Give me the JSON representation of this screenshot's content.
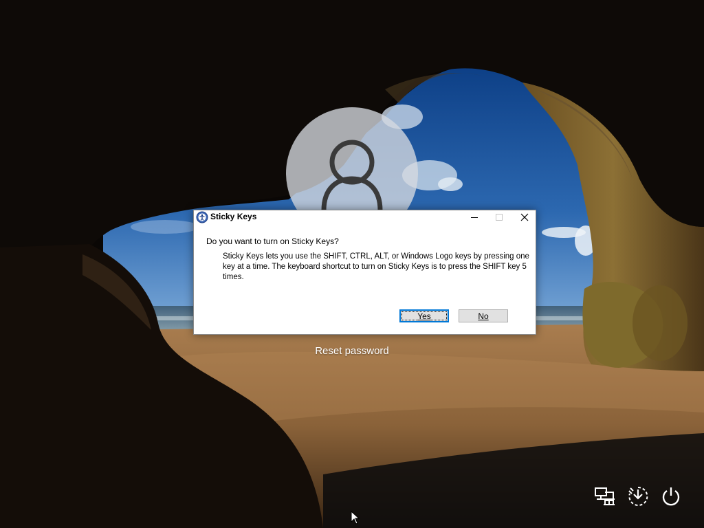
{
  "screen": {
    "type": "Windows lock screen"
  },
  "user": {
    "avatar_icon": "person-icon"
  },
  "reset_password": {
    "label": "Reset password"
  },
  "dialog": {
    "title": "Sticky Keys",
    "title_icon": "ease-of-access-icon",
    "question": "Do you want to turn on Sticky Keys?",
    "body": "Sticky Keys lets you use the SHIFT, CTRL, ALT, or Windows Logo keys by pressing one key at a time. The keyboard shortcut to turn on Sticky Keys is to press the SHIFT key 5 times.",
    "buttons": {
      "yes": "Yes",
      "no": "No"
    },
    "window_controls": [
      "minimize-icon",
      "maximize-icon",
      "close-icon"
    ]
  },
  "tray": {
    "icons": [
      "network-icon",
      "accessibility-icon",
      "power-icon"
    ]
  },
  "colors": {
    "accent": "#0078d7",
    "dialog_bg": "#ffffff",
    "button_bg": "#e1e1e1"
  }
}
